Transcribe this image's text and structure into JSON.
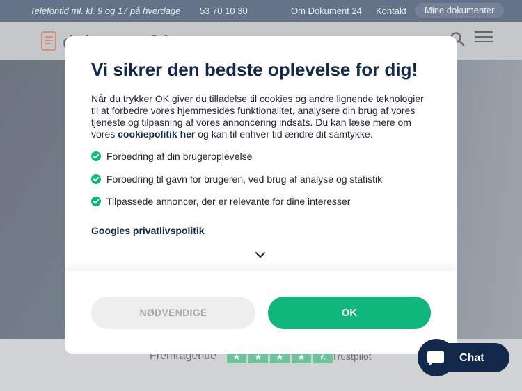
{
  "topbar": {
    "phone_text": "Telefontid ml. kl. 9 og 17 på hverdage",
    "phone_number": "53 70 10 30",
    "nav_about": "Om Dokument 24",
    "nav_contact": "Kontakt",
    "my_documents": "Mine dokumenter"
  },
  "header": {
    "logo_text": "dokument24"
  },
  "trustpilot": {
    "label": "Fremragende",
    "brand": "Trustpilot",
    "rating_stars": 5
  },
  "modal": {
    "title": "Vi sikrer den bedste oplevelse for dig!",
    "body_text": "Når du trykker OK giver du tilladelse til cookies og andre lignende teknologier til at forbedre vores hjemmesides funktionalitet, analysere din brug af vores tjeneste og tilpasning af vores annoncering indsats. Du kan læse mere om vores ",
    "cookie_link": "cookiepolitik her",
    "body_text_end": " og kan til enhver tid ændre dit samtykke.",
    "benefits": [
      "Forbedring af din brugeroplevelse",
      "Forbedring til gavn for brugeren, ved brug af analyse og statistik",
      "Tilpassede annoncer, der er relevante for dine interesser"
    ],
    "google_link": "Googles privatlivspolitik",
    "btn_necessary": "NØDVENDIGE",
    "btn_ok": "OK"
  },
  "chat": {
    "label": "Chat"
  },
  "colors": {
    "navy": "#13294b",
    "accent_green": "#11b67d",
    "trustpilot_green": "#1fa565"
  }
}
